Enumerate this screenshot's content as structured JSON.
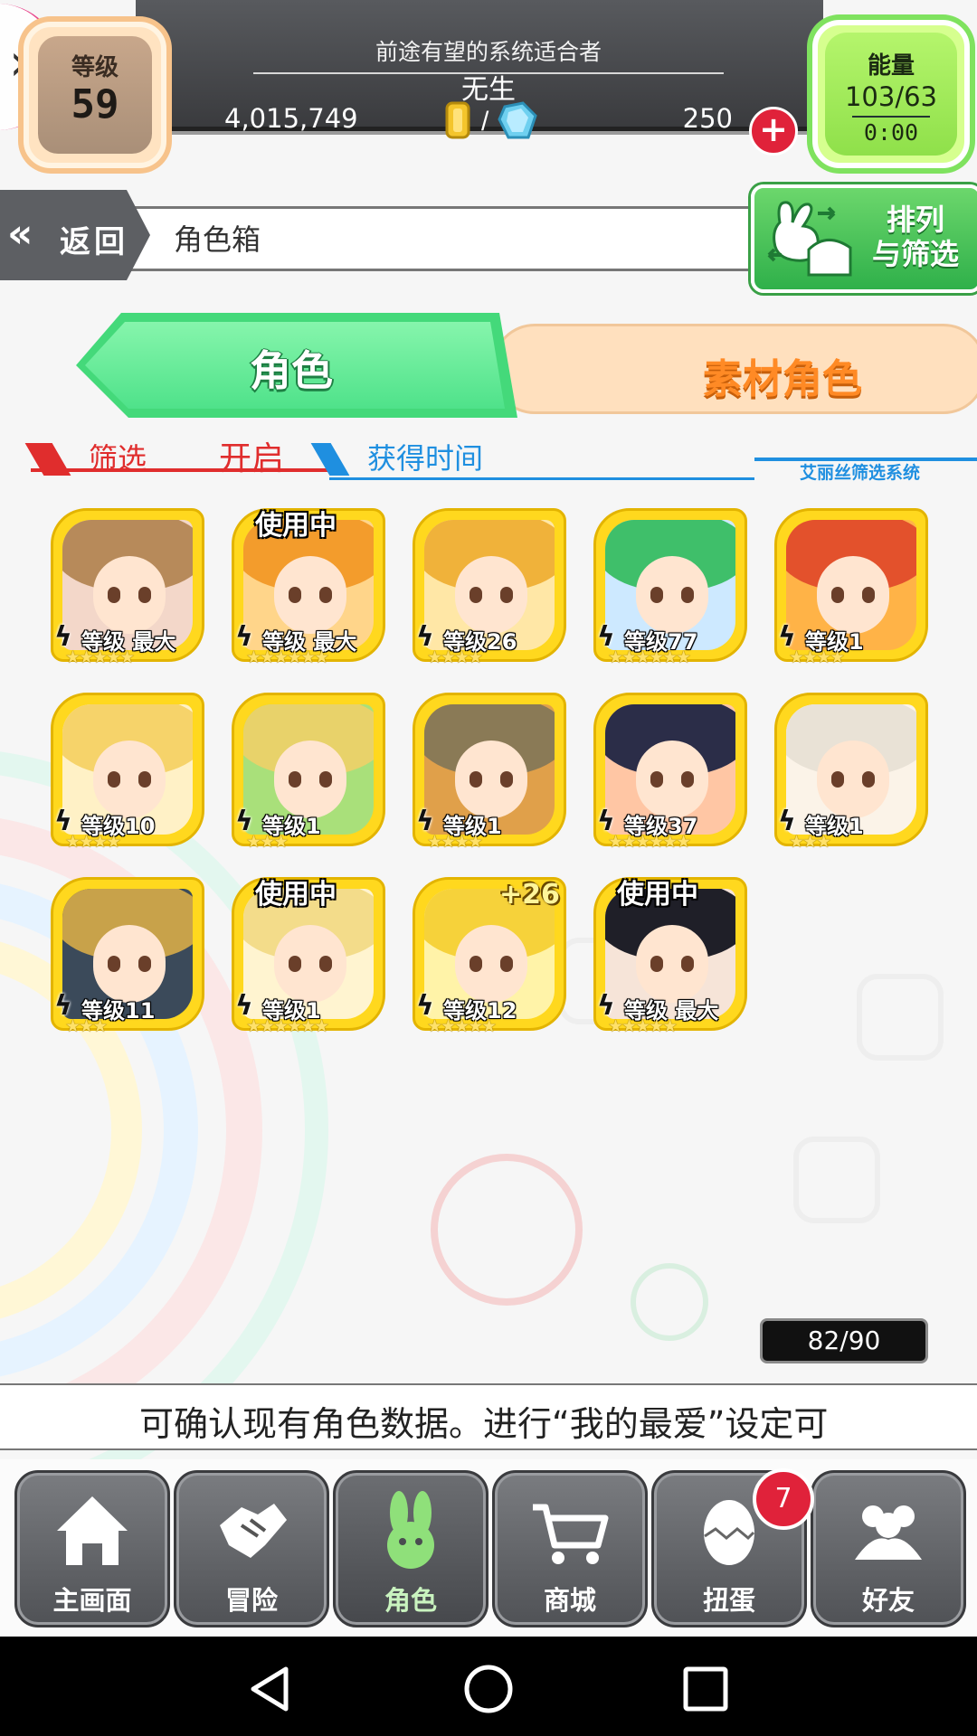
{
  "header": {
    "rank_label": "等级",
    "rank_value": "59",
    "player_title": "前途有望的系统适合者",
    "player_name": "无生",
    "money": "4,015,749",
    "currency_separator": "/",
    "gems": "250",
    "energy_label": "能量",
    "energy_value": "103/63",
    "energy_timer": "0:00"
  },
  "titlebar": {
    "back_label": "返回",
    "page_title": "角色箱",
    "sort_filter_label_line1": "排列",
    "sort_filter_label_line2": "与筛选"
  },
  "tabs": {
    "characters": "角色",
    "materials": "素材角色"
  },
  "filter": {
    "label": "筛选",
    "state": "开启",
    "sort_key": "获得时间",
    "system_label": "艾丽丝筛选系统"
  },
  "characters": [
    {
      "level": "等级 最大",
      "stars": 5,
      "in_use": "",
      "plus": "",
      "hair": "#b78a5a",
      "bg": "#f3d7c9"
    },
    {
      "level": "等级 最大",
      "stars": 6,
      "in_use": "使用中",
      "plus": "",
      "hair": "#f39c2c",
      "bg": "#ffd58a"
    },
    {
      "level": "等级26",
      "stars": 4,
      "in_use": "",
      "plus": "",
      "hair": "#f0b23a",
      "bg": "#ffe7a6"
    },
    {
      "level": "等级77",
      "stars": 6,
      "in_use": "",
      "plus": "",
      "hair": "#3fbf6a",
      "bg": "#cde9ff"
    },
    {
      "level": "等级1",
      "stars": 4,
      "in_use": "",
      "plus": "",
      "hair": "#e3512c",
      "bg": "#ffb347"
    },
    {
      "level": "等级10",
      "stars": 4,
      "in_use": "",
      "plus": "",
      "hair": "#f6d36a",
      "bg": "#fff1c6"
    },
    {
      "level": "等级1",
      "stars": 3,
      "in_use": "",
      "plus": "",
      "hair": "#e8d26a",
      "bg": "#a9e07a"
    },
    {
      "level": "等级1",
      "stars": 4,
      "in_use": "",
      "plus": "",
      "hair": "#8a7a56",
      "bg": "#e0a04a"
    },
    {
      "level": "等级37",
      "stars": 6,
      "in_use": "",
      "plus": "",
      "hair": "#2b2d48",
      "bg": "#ffc6a4"
    },
    {
      "level": "等级1",
      "stars": 3,
      "in_use": "",
      "plus": "",
      "hair": "#e9e2d6",
      "bg": "#fbf3e8"
    },
    {
      "level": "等级11",
      "stars": 3,
      "in_use": "",
      "plus": "",
      "hair": "#c8a24a",
      "bg": "#3b4a5a"
    },
    {
      "level": "等级1",
      "stars": 6,
      "in_use": "使用中",
      "plus": "",
      "hair": "#f3dc8a",
      "bg": "#fff4d0"
    },
    {
      "level": "等级12",
      "stars": 5,
      "in_use": "",
      "plus": "+26",
      "hair": "#f6d23a",
      "bg": "#fff3a8"
    },
    {
      "level": "等级 最大",
      "stars": 5,
      "in_use": "使用中",
      "plus": "",
      "hair": "#1f1f28",
      "bg": "#f6e4d8"
    }
  ],
  "inventory": {
    "count": "82/90"
  },
  "message": {
    "text": "可确认现有角色数据。进行“我的最爱”设定可"
  },
  "nav": {
    "items": [
      {
        "label": "主画面",
        "icon": "home-icon"
      },
      {
        "label": "冒险",
        "icon": "handshake-icon"
      },
      {
        "label": "角色",
        "icon": "rabbit-icon"
      },
      {
        "label": "商城",
        "icon": "cart-icon"
      },
      {
        "label": "扭蛋",
        "icon": "egg-icon"
      },
      {
        "label": "好友",
        "icon": "friends-icon"
      }
    ],
    "gacha_badge": "7",
    "active_index": 2
  },
  "colors": {
    "accent_green": "#44d97a",
    "accent_orange": "#ff8a25",
    "filter_red": "#e02d2d",
    "filter_blue": "#1f8fe0",
    "badge_red": "#e0223a",
    "card_gold": "#ffd81e"
  }
}
